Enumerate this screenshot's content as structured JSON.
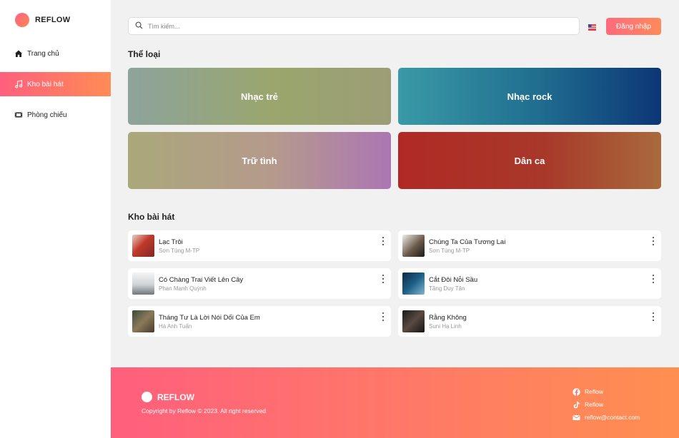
{
  "sidebar": {
    "brand": "REFLOW",
    "items": [
      {
        "label": "Trang chủ",
        "icon": "home-icon"
      },
      {
        "label": "Kho bài hát",
        "icon": "music-note-icon"
      },
      {
        "label": "Phòng chiếu",
        "icon": "film-icon"
      }
    ]
  },
  "header": {
    "search_placeholder": "Tìm kiếm...",
    "login_label": "Đăng nhập"
  },
  "genres": {
    "title": "Thể loại",
    "items": [
      "Nhạc trẻ",
      "Nhạc rock",
      "Trữ tình",
      "Dân ca"
    ]
  },
  "songs": {
    "title": "Kho bài hát",
    "items": [
      {
        "title": "Lạc Trôi",
        "artist": "Sơn Tùng M-TP"
      },
      {
        "title": "Chúng Ta Của Tương Lai",
        "artist": "Sơn Tùng M-TP"
      },
      {
        "title": "Có Chàng Trai Viết Lên Cây",
        "artist": "Phan Mạnh Quỳnh"
      },
      {
        "title": "Cắt Đôi Nỗi Sầu",
        "artist": "Tăng Duy Tân"
      },
      {
        "title": "Tháng Tư Là Lời Nói Dối Của Em",
        "artist": "Hà Anh Tuấn"
      },
      {
        "title": "Rằng Không",
        "artist": "Suni Hạ Linh"
      }
    ]
  },
  "footer": {
    "brand": "REFLOW",
    "copyright": "Copyright by Reflow © 2023. All right reserved",
    "links": [
      {
        "label": "Reflow",
        "icon": "facebook-icon"
      },
      {
        "label": "Reflow",
        "icon": "tiktok-icon"
      },
      {
        "label": "reflow@contact.com",
        "icon": "mail-icon"
      }
    ]
  },
  "colors": {
    "accent_start": "#ff5f7e",
    "accent_end": "#ff8c55"
  }
}
